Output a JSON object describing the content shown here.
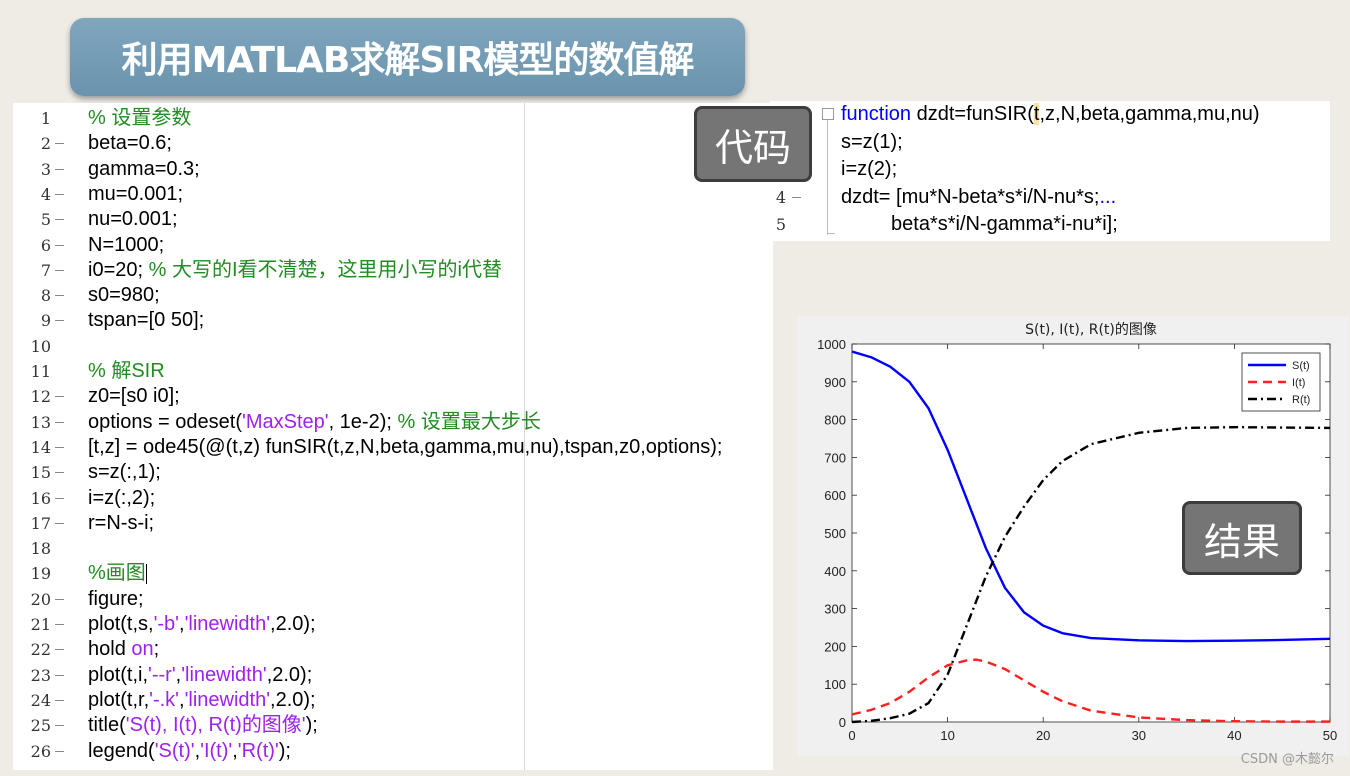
{
  "title": "利用MATLAB求解SIR模型的数值解",
  "labels": {
    "code": "代码",
    "result": "结果"
  },
  "watermark": "CSDN @木懿尔",
  "main_code": [
    {
      "n": "1",
      "dash": false,
      "parts": [
        [
          "cm",
          "% 设置参数"
        ]
      ]
    },
    {
      "n": "2",
      "dash": true,
      "parts": [
        [
          "t",
          "beta=0.6;"
        ]
      ]
    },
    {
      "n": "3",
      "dash": true,
      "parts": [
        [
          "t",
          "gamma=0.3;"
        ]
      ]
    },
    {
      "n": "4",
      "dash": true,
      "parts": [
        [
          "t",
          "mu=0.001;"
        ]
      ]
    },
    {
      "n": "5",
      "dash": true,
      "parts": [
        [
          "t",
          "nu=0.001;"
        ]
      ]
    },
    {
      "n": "6",
      "dash": true,
      "parts": [
        [
          "t",
          "N=1000;"
        ]
      ]
    },
    {
      "n": "7",
      "dash": true,
      "parts": [
        [
          "t",
          "i0=20; "
        ],
        [
          "cm",
          "% 大写的I看不清楚，这里用小写的i代替"
        ]
      ]
    },
    {
      "n": "8",
      "dash": true,
      "parts": [
        [
          "t",
          "s0=980;"
        ]
      ]
    },
    {
      "n": "9",
      "dash": true,
      "parts": [
        [
          "t",
          "tspan=[0 50];"
        ]
      ]
    },
    {
      "n": "10",
      "dash": false,
      "parts": []
    },
    {
      "n": "11",
      "dash": false,
      "parts": [
        [
          "cm",
          "% 解SIR"
        ]
      ]
    },
    {
      "n": "12",
      "dash": true,
      "parts": [
        [
          "t",
          "z0=[s0 i0];"
        ]
      ]
    },
    {
      "n": "13",
      "dash": true,
      "parts": [
        [
          "t",
          "options = odeset("
        ],
        [
          "st",
          "'MaxStep'"
        ],
        [
          "t",
          ", 1e-2); "
        ],
        [
          "cm",
          "% 设置最大步长"
        ]
      ]
    },
    {
      "n": "14",
      "dash": true,
      "parts": [
        [
          "t",
          "[t,z] = ode45(@(t,z) funSIR(t,z,N,beta,gamma,mu,nu),tspan,z0,options);"
        ]
      ]
    },
    {
      "n": "15",
      "dash": true,
      "parts": [
        [
          "t",
          "s=z(:,1);"
        ]
      ]
    },
    {
      "n": "16",
      "dash": true,
      "parts": [
        [
          "t",
          "i=z(:,2);"
        ]
      ]
    },
    {
      "n": "17",
      "dash": true,
      "parts": [
        [
          "t",
          "r=N-s-i;"
        ]
      ]
    },
    {
      "n": "18",
      "dash": false,
      "parts": []
    },
    {
      "n": "19",
      "dash": false,
      "parts": [
        [
          "cm",
          "%画图"
        ],
        [
          "cursor",
          ""
        ]
      ]
    },
    {
      "n": "20",
      "dash": true,
      "parts": [
        [
          "t",
          "figure;"
        ]
      ]
    },
    {
      "n": "21",
      "dash": true,
      "parts": [
        [
          "t",
          "plot(t,s,"
        ],
        [
          "st",
          "'-b'"
        ],
        [
          "t",
          ","
        ],
        [
          "st",
          "'linewidth'"
        ],
        [
          "t",
          ",2.0);"
        ]
      ]
    },
    {
      "n": "22",
      "dash": true,
      "parts": [
        [
          "t",
          "hold "
        ],
        [
          "st",
          "on"
        ],
        [
          "t",
          ";"
        ]
      ]
    },
    {
      "n": "23",
      "dash": true,
      "parts": [
        [
          "t",
          "plot(t,i,"
        ],
        [
          "st",
          "'--r'"
        ],
        [
          "t",
          ","
        ],
        [
          "st",
          "'linewidth'"
        ],
        [
          "t",
          ",2.0);"
        ]
      ]
    },
    {
      "n": "24",
      "dash": true,
      "parts": [
        [
          "t",
          "plot(t,r,"
        ],
        [
          "st",
          "'-.k'"
        ],
        [
          "t",
          ","
        ],
        [
          "st",
          "'linewidth'"
        ],
        [
          "t",
          ",2.0);"
        ]
      ]
    },
    {
      "n": "25",
      "dash": true,
      "parts": [
        [
          "t",
          "title("
        ],
        [
          "st",
          "'S(t), I(t), R(t)的图像'"
        ],
        [
          "t",
          ");"
        ]
      ]
    },
    {
      "n": "26",
      "dash": true,
      "parts": [
        [
          "t",
          "legend("
        ],
        [
          "st",
          "'S(t)'"
        ],
        [
          "t",
          ","
        ],
        [
          "st",
          "'I(t)'"
        ],
        [
          "t",
          ","
        ],
        [
          "st",
          "'R(t)'"
        ],
        [
          "t",
          ");"
        ]
      ]
    }
  ],
  "func_code": [
    {
      "n": "",
      "dash": false,
      "parts": [
        [
          "kw",
          "function"
        ],
        [
          "t",
          " dzdt=funSIR("
        ],
        [
          "hl",
          "t"
        ],
        [
          "t",
          ",z,N,beta,gamma,mu,nu)"
        ]
      ]
    },
    {
      "n": "",
      "dash": false,
      "parts": [
        [
          "t",
          "s=z(1);"
        ]
      ]
    },
    {
      "n": "",
      "dash": false,
      "parts": [
        [
          "t",
          "i=z(2);"
        ]
      ]
    },
    {
      "n": "4",
      "dash": true,
      "parts": [
        [
          "t",
          "dzdt= [mu*N-beta*s*i/N-nu*s;"
        ],
        [
          "kw",
          "..."
        ]
      ]
    },
    {
      "n": "5",
      "dash": false,
      "parts": [
        [
          "t",
          "         beta*s*i/N-gamma*i-nu*i];"
        ]
      ]
    }
  ],
  "chart_data": {
    "type": "line",
    "title": "S(t), I(t), R(t)的图像",
    "xlim": [
      0,
      50
    ],
    "ylim": [
      0,
      1000
    ],
    "xticks": [
      0,
      10,
      20,
      30,
      40,
      50
    ],
    "yticks": [
      0,
      100,
      200,
      300,
      400,
      500,
      600,
      700,
      800,
      900,
      1000
    ],
    "legend_position": "top-right",
    "series": [
      {
        "name": "S(t)",
        "color": "#0000ff",
        "dash": "solid",
        "x": [
          0,
          2,
          4,
          6,
          8,
          10,
          12,
          14,
          16,
          18,
          20,
          22,
          25,
          30,
          35,
          40,
          45,
          50
        ],
        "y": [
          980,
          965,
          940,
          900,
          830,
          720,
          590,
          460,
          355,
          290,
          255,
          235,
          222,
          216,
          214,
          215,
          217,
          220
        ]
      },
      {
        "name": "I(t)",
        "color": "#ff2020",
        "dash": "dashed",
        "x": [
          0,
          2,
          4,
          6,
          8,
          10,
          12,
          13,
          14,
          16,
          18,
          20,
          22,
          25,
          30,
          35,
          40,
          45,
          50
        ],
        "y": [
          20,
          32,
          50,
          80,
          118,
          150,
          163,
          165,
          160,
          140,
          110,
          80,
          55,
          30,
          12,
          5,
          2,
          1,
          1
        ]
      },
      {
        "name": "R(t)",
        "color": "#000000",
        "dash": "dashdot",
        "x": [
          0,
          2,
          4,
          6,
          8,
          10,
          12,
          14,
          16,
          18,
          20,
          22,
          25,
          30,
          35,
          40,
          45,
          50
        ],
        "y": [
          0,
          3,
          10,
          22,
          50,
          125,
          255,
          385,
          490,
          570,
          640,
          690,
          735,
          765,
          778,
          780,
          779,
          778
        ]
      }
    ]
  }
}
